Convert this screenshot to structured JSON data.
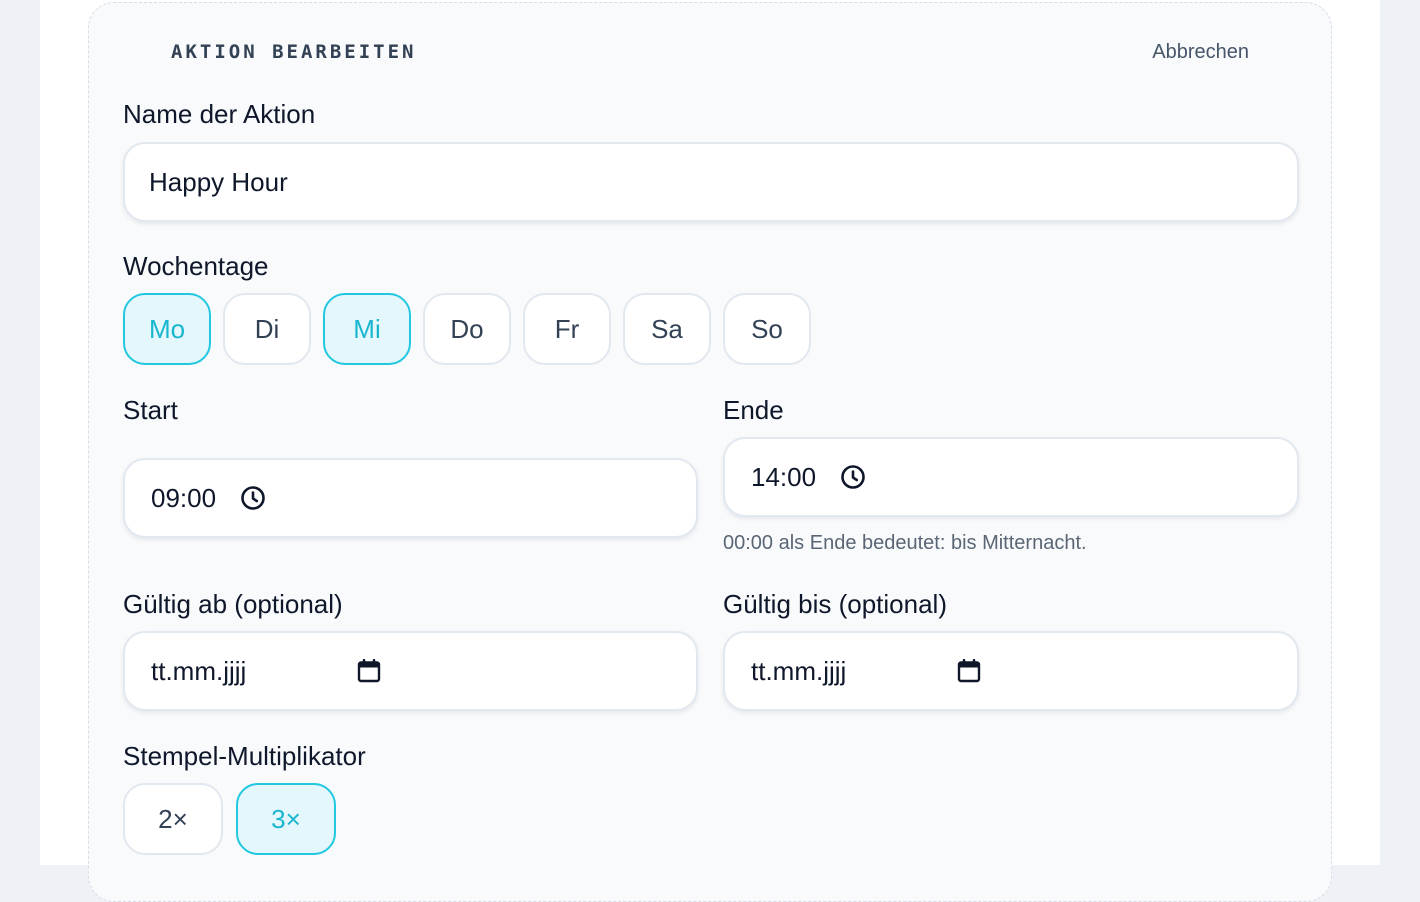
{
  "header": {
    "title": "AKTION BEARBEITEN",
    "cancel_label": "Abbrechen"
  },
  "name_field": {
    "label": "Name der Aktion",
    "value": "Happy Hour"
  },
  "weekdays": {
    "label": "Wochentage",
    "days": [
      {
        "label": "Mo",
        "selected": true
      },
      {
        "label": "Di",
        "selected": false
      },
      {
        "label": "Mi",
        "selected": true
      },
      {
        "label": "Do",
        "selected": false
      },
      {
        "label": "Fr",
        "selected": false
      },
      {
        "label": "Sa",
        "selected": false
      },
      {
        "label": "So",
        "selected": false
      }
    ]
  },
  "start": {
    "label": "Start",
    "value": "09:00",
    "icon": "clock-icon"
  },
  "end": {
    "label": "Ende",
    "value": "14:00",
    "icon": "clock-icon",
    "hint": "00:00 als Ende bedeutet: bis Mitternacht."
  },
  "valid_from": {
    "label": "Gültig ab (optional)",
    "placeholder": "tt.mm.jjjj",
    "icon": "calendar-icon"
  },
  "valid_until": {
    "label": "Gültig bis (optional)",
    "placeholder": "tt.mm.jjjj",
    "icon": "calendar-icon"
  },
  "multiplier": {
    "label": "Stempel-Multiplikator",
    "options": [
      {
        "label": "2×",
        "selected": false
      },
      {
        "label": "3×",
        "selected": true
      }
    ]
  },
  "colors": {
    "accent": "#22c7e0",
    "accent_bg": "#e3f7fc"
  }
}
